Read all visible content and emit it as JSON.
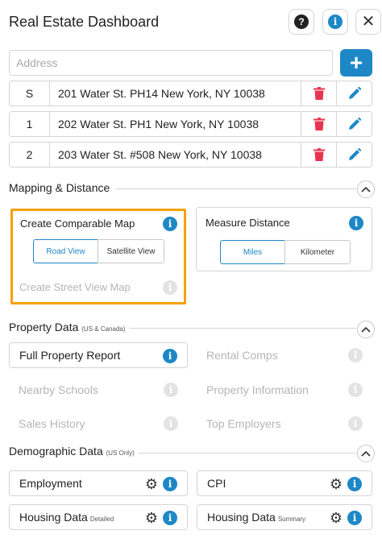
{
  "app": {
    "title": "Real Estate Dashboard"
  },
  "address": {
    "placeholder": "Address"
  },
  "properties": [
    {
      "label": "S",
      "address": "201 Water St. PH14 New York, NY 10038"
    },
    {
      "label": "1",
      "address": "202 Water St. PH1 New York, NY 10038"
    },
    {
      "label": "2",
      "address": "203 Water St. #508 New York, NY 10038"
    }
  ],
  "mapping": {
    "title": "Mapping & Distance",
    "comparable_map": {
      "title": "Create Comparable Map",
      "road_view": "Road View",
      "satellite_view": "Satellite View"
    },
    "street_view": "Create Street View Map",
    "measure": {
      "title": "Measure Distance",
      "miles": "Miles",
      "kilometer": "Kilometer"
    }
  },
  "property_data": {
    "title": "Property Data",
    "subtitle": "(US & Canada)",
    "full_report": "Full Property Report",
    "rental_comps": "Rental Comps",
    "nearby_schools": "Nearby Schools",
    "property_information": "Property Information",
    "sales_history": "Sales History",
    "top_employers": "Top Employers"
  },
  "demographic": {
    "title": "Demographic Data",
    "subtitle": "(US Only)",
    "employment": "Employment",
    "cpi": "CPI",
    "housing_detailed": {
      "label": "Housing Data",
      "suffix": "Detailed"
    },
    "housing_summary": {
      "label": "Housing Data",
      "suffix": "Summary"
    }
  },
  "colors": {
    "accent": "#1e88c7",
    "delete": "#e8344f",
    "highlight": "#f5a100"
  },
  "icons": {
    "help": "help-circle-icon",
    "info": "info-icon",
    "close": "close-icon",
    "add": "plus-icon",
    "delete": "trash-icon",
    "edit": "pencil-icon",
    "collapse": "chevron-up-icon",
    "settings": "gear-icon"
  }
}
